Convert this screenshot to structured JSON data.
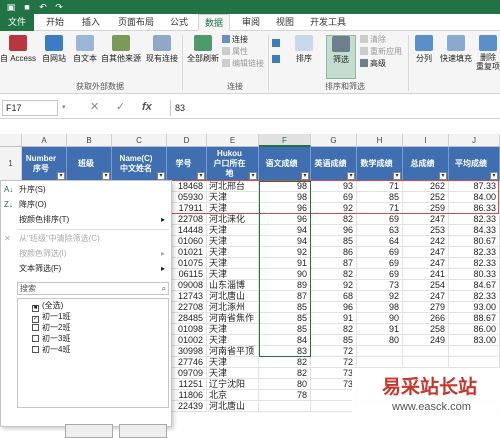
{
  "tabs": [
    "文件",
    "开始",
    "插入",
    "页面布局",
    "公式",
    "数据",
    "审阅",
    "视图",
    "开发工具"
  ],
  "active_tab": "数据",
  "ribbon": {
    "external": [
      "自 Access",
      "自网站",
      "自文本",
      "自其他来源",
      "现有连接"
    ],
    "external_group": "获取外部数据",
    "refresh": "全部刷新",
    "conn_small": [
      "连接",
      "属性",
      "编辑链接"
    ],
    "conn_group": "连接",
    "sort": "排序",
    "filter": "筛选",
    "sort_small": [
      "清除",
      "重新应用",
      "高级"
    ],
    "sort_group": "排序和筛选",
    "split": "分列",
    "flash": "快速填充",
    "dedup": "删除\n重复项"
  },
  "formula_bar": {
    "name_box": "F17",
    "fx": "fx",
    "value": "83"
  },
  "columns": [
    "A",
    "B",
    "C",
    "D",
    "E",
    "F",
    "G",
    "H",
    "I",
    "J"
  ],
  "headers": [
    "Number\n序号",
    "班级",
    "Name(C)\n中文姓名",
    "学号",
    "Hukou\n户口所在\n地",
    "语文成绩",
    "英语成绩",
    "数学成绩",
    "总成绩",
    "平均成绩"
  ],
  "rows": [
    [
      "18468",
      "河北邢台",
      "98",
      "93",
      "71",
      "262",
      "87.33"
    ],
    [
      "05930",
      "天津",
      "98",
      "69",
      "85",
      "252",
      "84.00"
    ],
    [
      "17911",
      "天津",
      "96",
      "92",
      "71",
      "259",
      "86.33"
    ],
    [
      "22708",
      "河北涞化",
      "96",
      "82",
      "69",
      "247",
      "82.33"
    ],
    [
      "14448",
      "天津",
      "94",
      "96",
      "63",
      "253",
      "84.33"
    ],
    [
      "01060",
      "天津",
      "94",
      "85",
      "64",
      "242",
      "80.67"
    ],
    [
      "01021",
      "天津",
      "92",
      "86",
      "69",
      "247",
      "82.33"
    ],
    [
      "01075",
      "天津",
      "91",
      "87",
      "69",
      "247",
      "82.33"
    ],
    [
      "06115",
      "天津",
      "90",
      "82",
      "69",
      "241",
      "80.33"
    ],
    [
      "09008",
      "山东淄博",
      "89",
      "92",
      "73",
      "254",
      "84.67"
    ],
    [
      "12743",
      "河北唐山",
      "87",
      "68",
      "92",
      "247",
      "82.33"
    ],
    [
      "22708",
      "河北涿州",
      "85",
      "96",
      "98",
      "279",
      "93.00"
    ],
    [
      "28485",
      "河南省焦作",
      "85",
      "91",
      "90",
      "266",
      "88.67"
    ],
    [
      "01098",
      "天津",
      "85",
      "82",
      "91",
      "258",
      "86.00"
    ],
    [
      "01002",
      "天津",
      "84",
      "85",
      "80",
      "249",
      "83.00"
    ],
    [
      "30998",
      "河南省平顶",
      "83",
      "72",
      "",
      "",
      ""
    ],
    [
      "27746",
      "天津",
      "82",
      "72",
      "",
      "",
      ""
    ],
    [
      "09709",
      "天津",
      "82",
      "73",
      "",
      "",
      ""
    ],
    [
      "11251",
      "辽宁沈阳",
      "80",
      "73",
      "",
      "",
      ""
    ],
    [
      "11806",
      "北京",
      "78",
      "",
      "",
      "",
      ""
    ],
    [
      "22439",
      "河北唐山",
      "",
      "",
      "",
      "",
      ""
    ]
  ],
  "menu": {
    "sort_asc": "升序(S)",
    "sort_desc": "降序(O)",
    "sort_color": "按颜色排序(T)",
    "clear": "从\"班级\"中清除筛选(C)",
    "filter_color": "按颜色筛选(I)",
    "text_filter": "文本筛选(F)",
    "search_placeholder": "搜索",
    "items": [
      "(全选)",
      "初一1班",
      "初一2班",
      "初一3班",
      "初一4班"
    ]
  },
  "watermark": {
    "title": "易采站长站",
    "url": "www.easck.com"
  }
}
